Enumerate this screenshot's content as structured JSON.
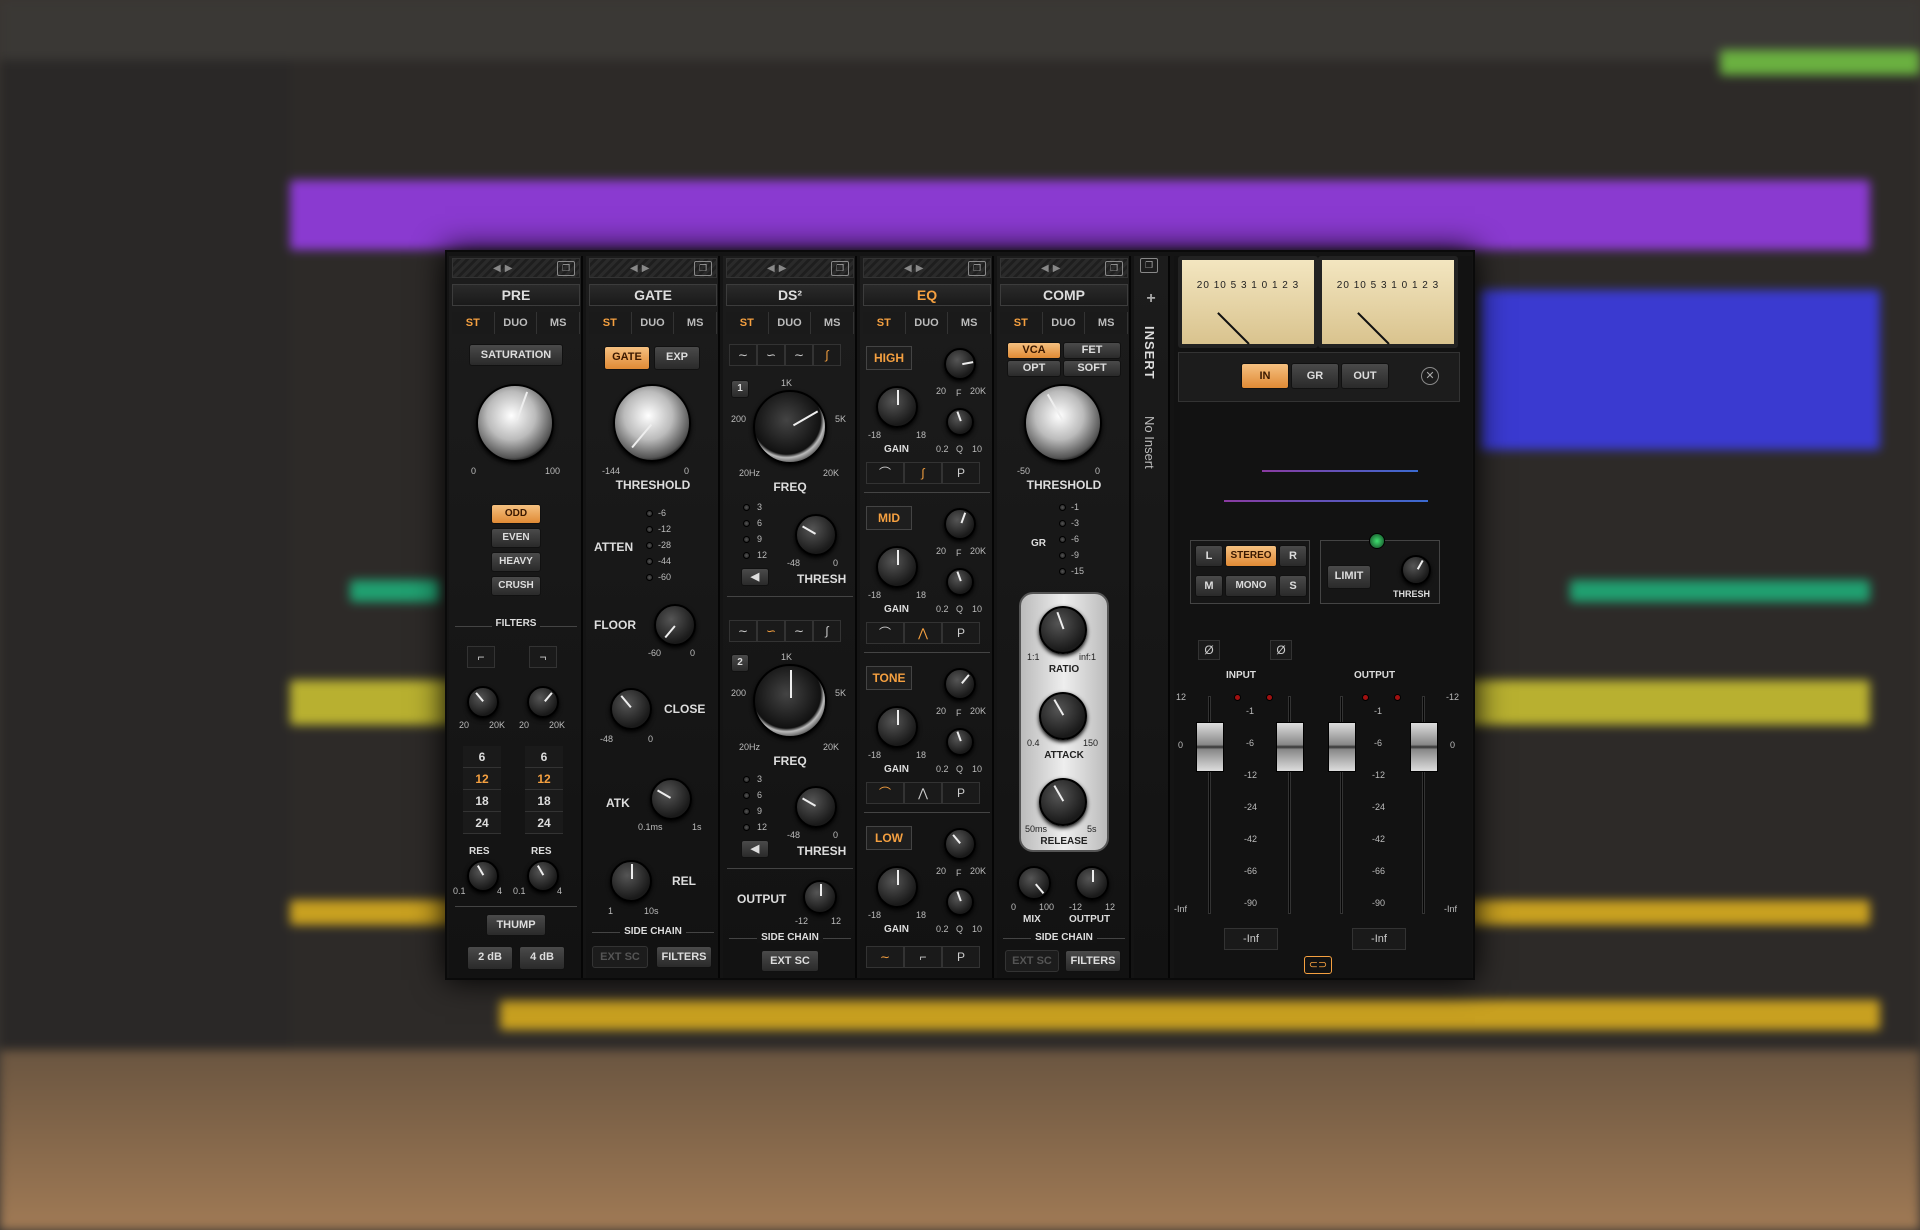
{
  "pre": {
    "title": "PRE",
    "modes": [
      "ST",
      "DUO",
      "MS"
    ],
    "saturation": "SATURATION",
    "knob_min": "0",
    "knob_max": "100",
    "types": [
      "ODD",
      "EVEN",
      "HEAVY",
      "CRUSH"
    ],
    "filters": "FILTERS",
    "f_min": "20",
    "f_max": "20K",
    "slopes": [
      "6",
      "12",
      "18",
      "24"
    ],
    "res": "RES",
    "res_min": "0.1",
    "res_max": "4",
    "thump": "THUMP",
    "db2": "2 dB",
    "db4": "4 dB"
  },
  "gate": {
    "title": "GATE",
    "modes": [
      "ST",
      "DUO",
      "MS"
    ],
    "gate": "GATE",
    "exp": "EXP",
    "threshold": "THRESHOLD",
    "th_min": "-144",
    "th_max": "0",
    "atten": "ATTEN",
    "atten_vals": [
      "-6",
      "-12",
      "-28",
      "-44",
      "-60"
    ],
    "floor": "FLOOR",
    "fl_min": "-60",
    "fl_max": "0",
    "close": "CLOSE",
    "cl_min": "-48",
    "cl_max": "0",
    "atk": "ATK",
    "atk_min": "0.1ms",
    "atk_max": "1s",
    "rel": "REL",
    "rel_min": "1",
    "rel_max": "10s",
    "side_chain": "SIDE CHAIN",
    "ext_sc": "EXT SC",
    "filters": "FILTERS"
  },
  "ds": {
    "title": "DS²",
    "modes": [
      "ST",
      "DUO",
      "MS"
    ],
    "b1": "1",
    "b2": "2",
    "f_1k": "1K",
    "f_200": "200",
    "f_5k": "5K",
    "f_20hz": "20Hz",
    "f_20k": "20K",
    "freq": "FREQ",
    "gr": [
      "3",
      "6",
      "9",
      "12"
    ],
    "thresh": "THRESH",
    "th_min": "-48",
    "th_max": "0",
    "output": "OUTPUT",
    "out_min": "-12",
    "out_max": "12",
    "side_chain": "SIDE CHAIN",
    "ext_sc": "EXT SC"
  },
  "eq": {
    "title": "EQ",
    "modes": [
      "ST",
      "DUO",
      "MS"
    ],
    "bands": [
      "HIGH",
      "MID",
      "TONE",
      "LOW"
    ],
    "gain": "GAIN",
    "g_min": "-18",
    "g_max": "18",
    "f": "F",
    "f_min": "20",
    "f_max": "20K",
    "q": "Q",
    "q_min": "0.2",
    "q_max": "10",
    "p": "P"
  },
  "comp": {
    "title": "COMP",
    "modes": [
      "ST",
      "DUO",
      "MS"
    ],
    "types": [
      "VCA",
      "FET",
      "OPT",
      "SOFT"
    ],
    "threshold": "THRESHOLD",
    "th_min": "-50",
    "th_max": "0",
    "gr": "GR",
    "gr_vals": [
      "-1",
      "-3",
      "-6",
      "-9",
      "-15"
    ],
    "ratio": "RATIO",
    "r_min": "1:1",
    "r_max": "inf:1",
    "attack": "ATTACK",
    "a_min": "0.4",
    "a_max": "150",
    "release": "RELEASE",
    "rel_min": "50ms",
    "rel_max": "5s",
    "mix": "MIX",
    "mix_min": "0",
    "mix_max": "100",
    "output": "OUTPUT",
    "out_min": "-12",
    "out_max": "12",
    "side_chain": "SIDE CHAIN",
    "ext_sc": "EXT SC",
    "filters": "FILTERS"
  },
  "insert": {
    "plus": "+",
    "label": "INSERT",
    "value": "No Insert"
  },
  "master": {
    "vu_scale": "20 10 5 3 1 0 1 2 3",
    "in": "IN",
    "gr": "GR",
    "out": "OUT",
    "l": "L",
    "stereo": "STEREO",
    "r": "R",
    "m": "M",
    "mono": "MONO",
    "s": "S",
    "limit": "LIMIT",
    "thresh": "THRESH",
    "phase": "Ø",
    "input": "INPUT",
    "output": "OUTPUT",
    "scale_l": [
      "12",
      "0",
      "-Inf"
    ],
    "scale_r": [
      "-12",
      "0",
      "-Inf"
    ],
    "meter_vals": [
      "-1",
      "-6",
      "-12",
      "-24",
      "-42",
      "-66",
      "-90"
    ],
    "in_read": "-Inf",
    "out_read": "-Inf"
  }
}
